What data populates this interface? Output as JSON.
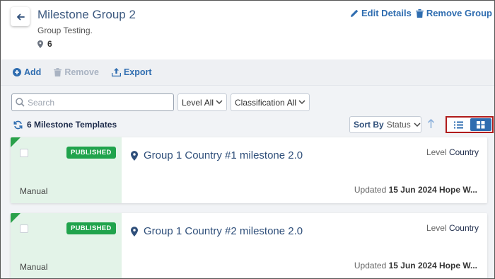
{
  "header": {
    "title": "Milestone Group 2",
    "subtitle": "Group Testing.",
    "count": "6",
    "edit_label": "Edit Details",
    "remove_label": "Remove Group"
  },
  "toolbar": {
    "add_label": "Add",
    "remove_label": "Remove",
    "export_label": "Export"
  },
  "filters": {
    "search_placeholder": "Search",
    "level_label": "Level",
    "level_value": "All",
    "classification_label": "Classification",
    "classification_value": "All"
  },
  "list": {
    "summary": "6 Milestone Templates",
    "sort_label": "Sort By",
    "sort_value": "Status",
    "view_mode": "grid"
  },
  "cards": [
    {
      "badge": "PUBLISHED",
      "type": "Manual",
      "title": "Group 1 Country #1 milestone 2.0",
      "level_label": "Level",
      "level_value": "Country",
      "updated_label": "Updated",
      "updated_date": "15 Jun 2024",
      "updated_by": "Hope W..."
    },
    {
      "badge": "PUBLISHED",
      "type": "Manual",
      "title": "Group 1 Country #2 milestone 2.0",
      "level_label": "Level",
      "level_value": "Country",
      "updated_label": "Updated",
      "updated_date": "15 Jun 2024",
      "updated_by": "Hope W..."
    }
  ],
  "colors": {
    "accent": "#2f6db0",
    "published": "#20a34c",
    "card_left_bg": "#e3f3e8",
    "highlight_border": "#b01b1b"
  }
}
